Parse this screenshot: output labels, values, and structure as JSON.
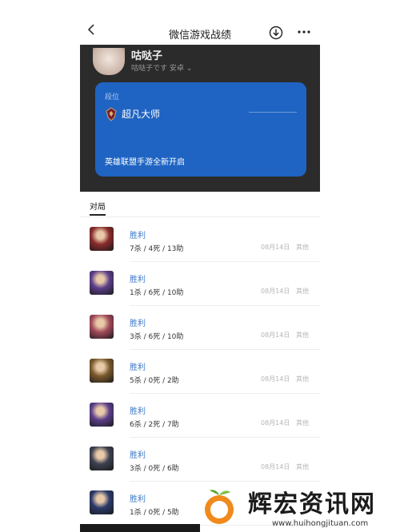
{
  "nav": {
    "title": "微信游戏战绩"
  },
  "profile": {
    "name": "咕哒子",
    "subtitle": "咕哒子です 安卓",
    "rank_card": {
      "label": "段位",
      "rank": "超凡大师",
      "promo": "英雄联盟手游全新开启"
    }
  },
  "tabs": [
    {
      "label": "对局",
      "active": true
    }
  ],
  "matches": [
    {
      "result": "胜利",
      "kda": "7杀 / 4死 / 13助",
      "date": "08月14日",
      "mode": "其他",
      "hero_color": "#8a2b2b"
    },
    {
      "result": "胜利",
      "kda": "1杀 / 6死 / 10助",
      "date": "08月14日",
      "mode": "其他",
      "hero_color": "#5b3e8a"
    },
    {
      "result": "胜利",
      "kda": "3杀 / 6死 / 10助",
      "date": "08月14日",
      "mode": "其他",
      "hero_color": "#a24a5a"
    },
    {
      "result": "胜利",
      "kda": "5杀 / 0死 / 2助",
      "date": "08月14日",
      "mode": "其他",
      "hero_color": "#7a5a2c"
    },
    {
      "result": "胜利",
      "kda": "6杀 / 2死 / 7助",
      "date": "08月14日",
      "mode": "其他",
      "hero_color": "#5b3e8a"
    },
    {
      "result": "胜利",
      "kda": "3杀 / 0死 / 6助",
      "date": "08月14日",
      "mode": "其他",
      "hero_color": "#3d4150"
    },
    {
      "result": "胜利",
      "kda": "1杀 / 0死 / 5助",
      "date": "",
      "mode": "",
      "hero_color": "#2b3a6a"
    }
  ],
  "watermark": {
    "brand": "辉宏资讯网",
    "url": "www.huihongjituan.com"
  },
  "colors": {
    "accent": "#1f64c2",
    "win": "#3c78c7",
    "dark": "#2b2b2b"
  }
}
